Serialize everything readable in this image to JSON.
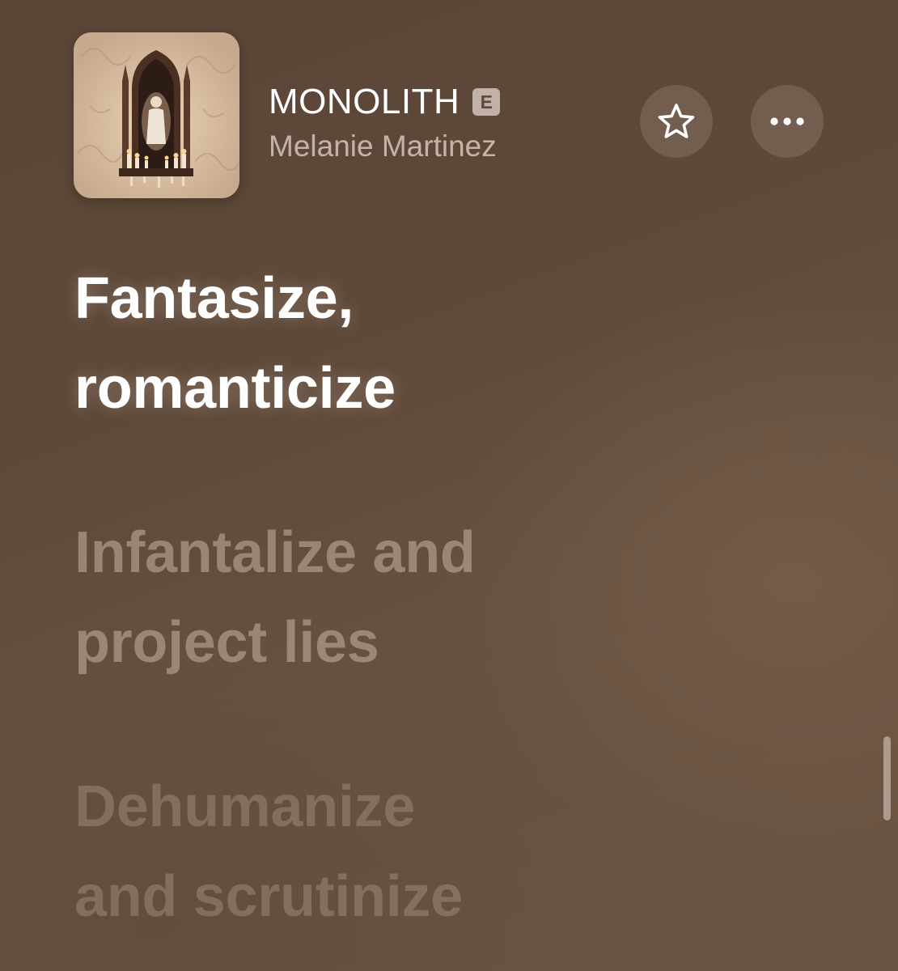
{
  "now_playing": {
    "title": "MONOLITH",
    "explicit_badge": "E",
    "artist": "Melanie Martinez",
    "album_art_icon": "album-cover-shrine",
    "favorite_icon": "star-outline-icon",
    "more_icon": "ellipsis-icon"
  },
  "lyrics": [
    {
      "state": "active",
      "lines": [
        "Fantasize,",
        "romanticize"
      ]
    },
    {
      "state": "upcoming",
      "lines": [
        "Infantalize and",
        "project lies"
      ]
    },
    {
      "state": "upcoming",
      "lines": [
        "Dehumanize",
        "and scrutinize"
      ]
    }
  ],
  "colors": {
    "background": "#5e4939",
    "active_lyric": "#ffffff",
    "inactive_lyric": "#cdb9aa",
    "button_fill": "#bea8a0"
  }
}
